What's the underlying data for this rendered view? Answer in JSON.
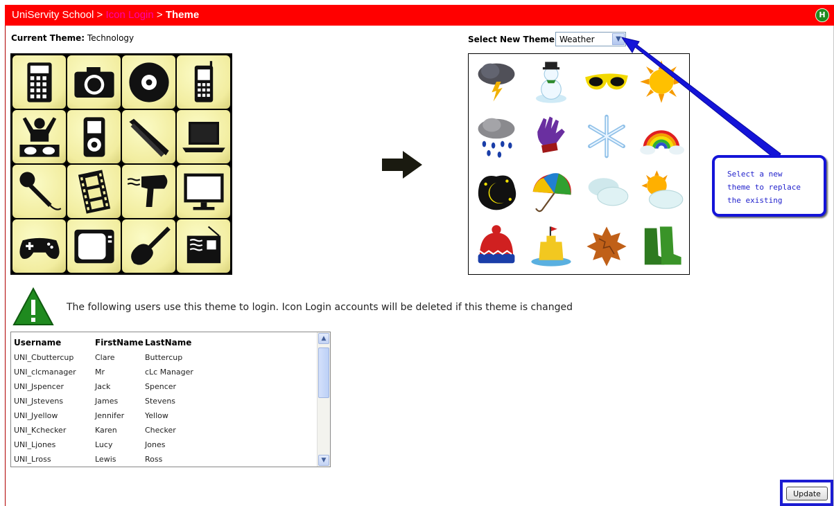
{
  "header": {
    "crumb_home": "UniServity School",
    "crumb_sep1": " > ",
    "crumb_link": "Icon Login",
    "crumb_sep2": " > ",
    "crumb_current": "Theme",
    "help_label": "H"
  },
  "current_theme": {
    "label": "Current Theme:",
    "value": "Technology",
    "icons": [
      "calculator-icon",
      "camera-icon",
      "cd-icon",
      "mobile-phone-icon",
      "dj-icon",
      "mp3-player-icon",
      "hair-straightener-icon",
      "laptop-icon",
      "microphone-icon",
      "film-strip-icon",
      "hair-dryer-icon",
      "monitor-icon",
      "gamepad-icon",
      "television-icon",
      "electric-guitar-icon",
      "radio-icon"
    ]
  },
  "new_theme": {
    "label": "Select New Theme",
    "selected": "Weather",
    "icons": [
      "storm-cloud-icon",
      "snowman-icon",
      "sunglasses-icon",
      "sun-icon",
      "rain-cloud-icon",
      "gloves-icon",
      "snowflake-icon",
      "rainbow-icon",
      "night-sky-icon",
      "umbrella-icon",
      "clouds-icon",
      "sun-cloud-icon",
      "woolly-hat-icon",
      "sandcastle-icon",
      "autumn-leaves-icon",
      "wellington-boots-icon"
    ]
  },
  "callout": {
    "line1": "Select  a new",
    "line2": "theme to replace",
    "line3": "the existing"
  },
  "warning": {
    "text": "The following users use this theme to login. Icon Login accounts will be deleted if this theme is changed"
  },
  "users": {
    "headers": [
      "Username",
      "FirstName",
      "LastName"
    ],
    "rows": [
      [
        "UNI_Cbuttercup",
        "Clare",
        "Buttercup"
      ],
      [
        "UNI_clcmanager",
        "Mr",
        "cLc Manager"
      ],
      [
        "UNI_Jspencer",
        "Jack",
        "Spencer"
      ],
      [
        "UNI_Jstevens",
        "James",
        "Stevens"
      ],
      [
        "UNI_Jyellow",
        "Jennifer",
        "Yellow"
      ],
      [
        "UNI_Kchecker",
        "Karen",
        "Checker"
      ],
      [
        "UNI_Ljones",
        "Lucy",
        "Jones"
      ],
      [
        "UNI_Lross",
        "Lewis",
        "Ross"
      ]
    ]
  },
  "actions": {
    "update_label": "Update"
  },
  "colors": {
    "header": "#ff0000",
    "callout": "#1414d8",
    "tile": "#f2eda0"
  }
}
